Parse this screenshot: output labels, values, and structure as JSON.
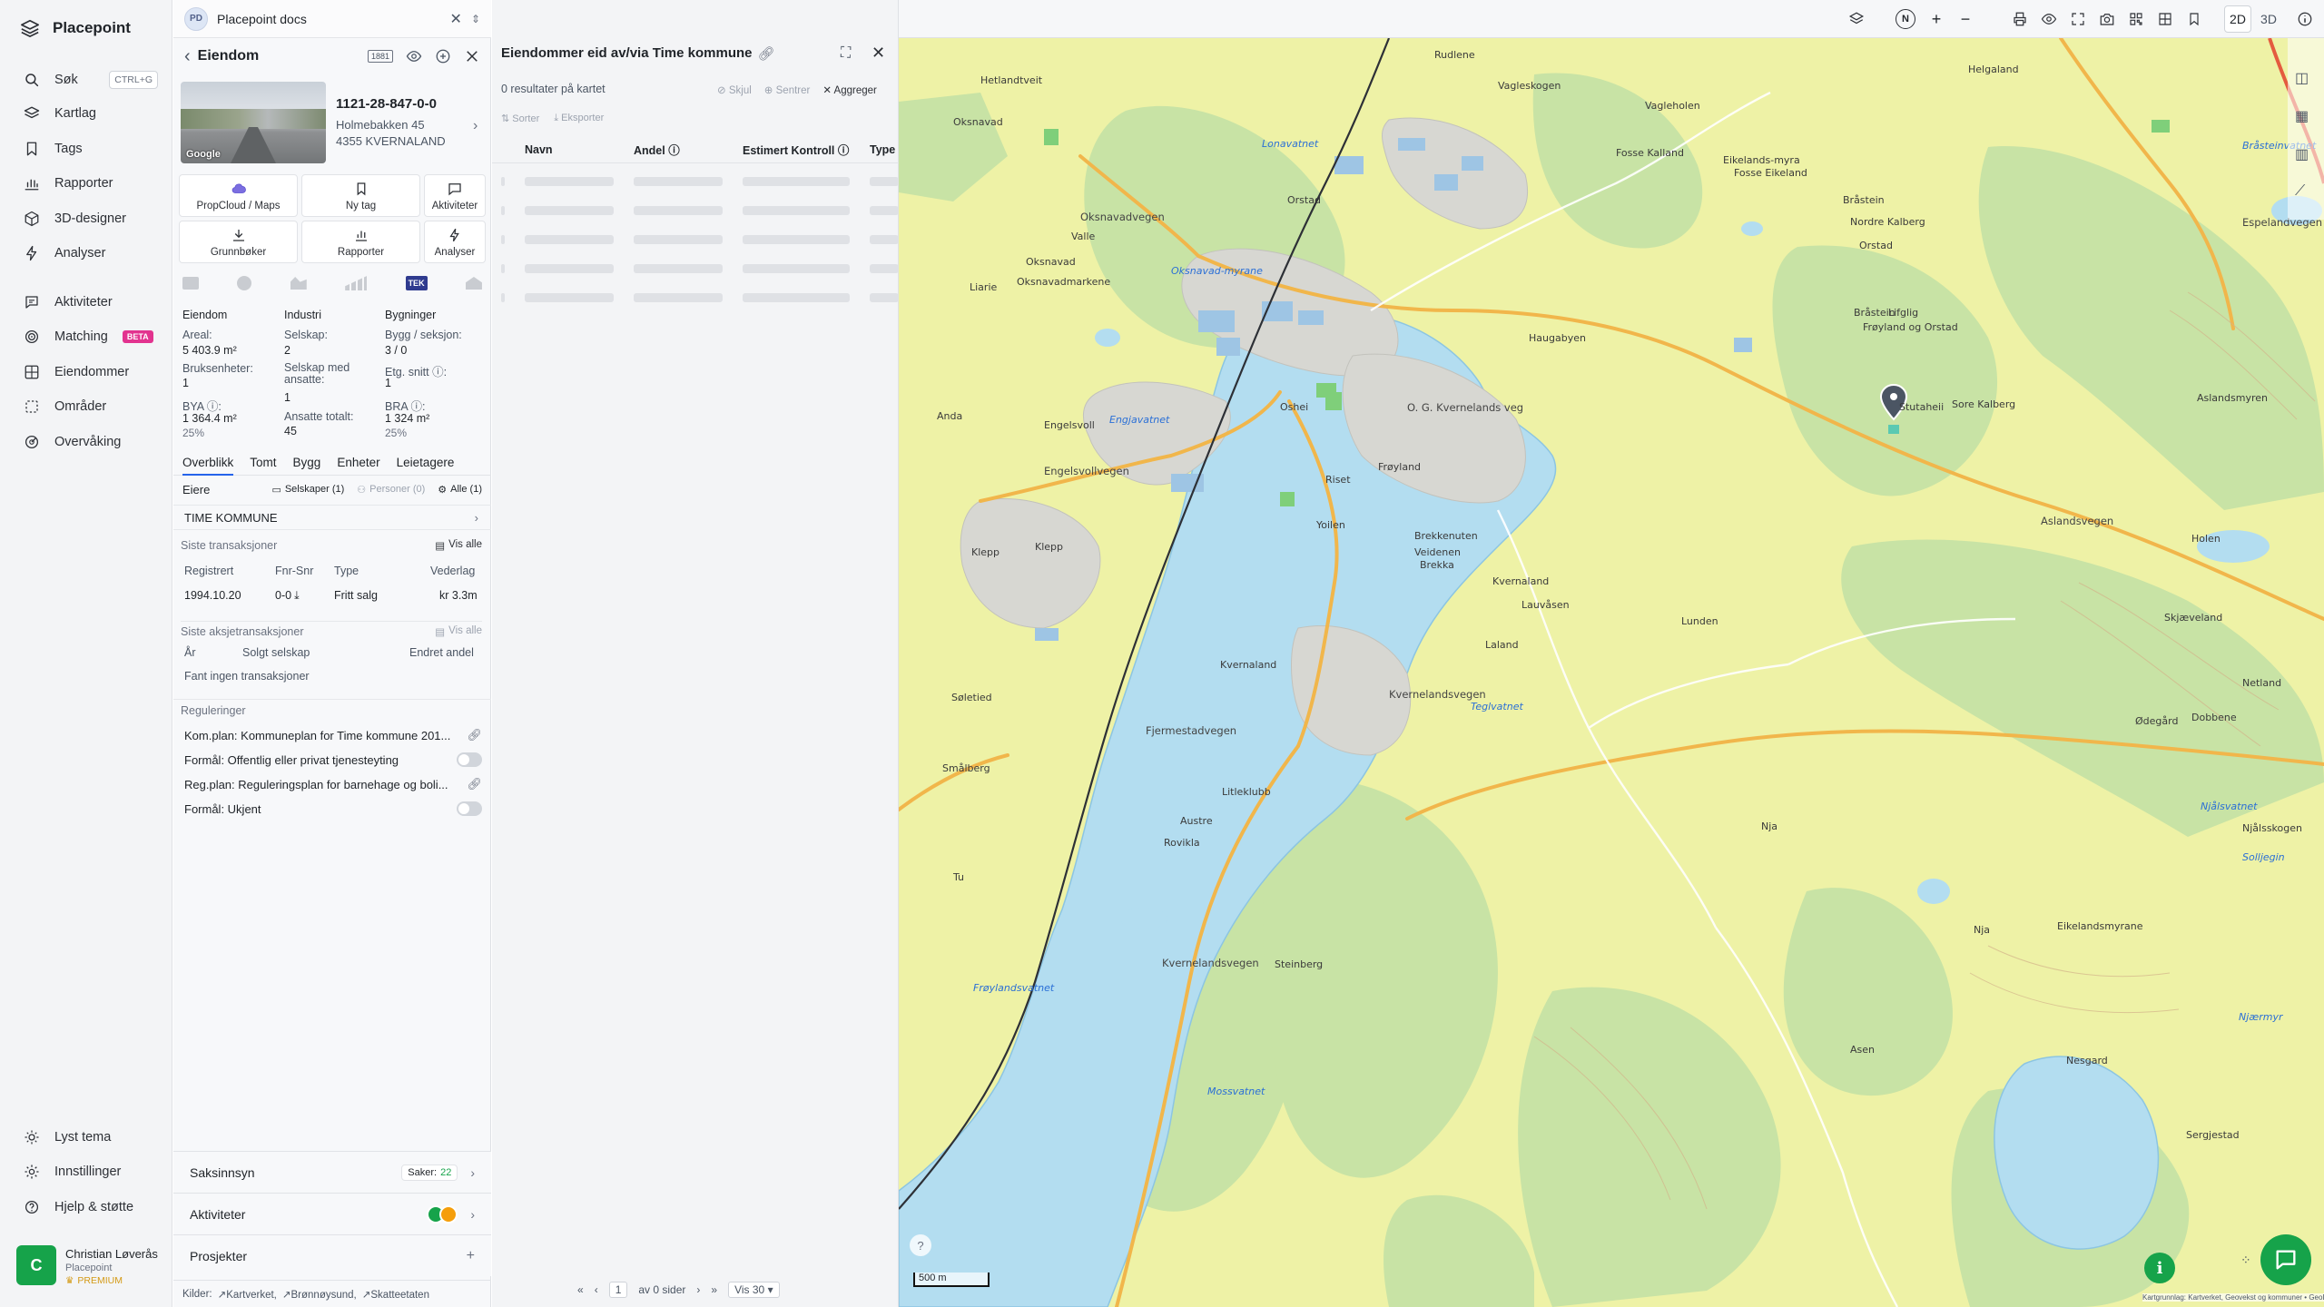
{
  "app": {
    "name": "Placepoint"
  },
  "sidebar": {
    "search": {
      "label": "Søk",
      "shortcut": "CTRL+G"
    },
    "items": [
      {
        "label": "Kartlag",
        "icon": "layers-icon"
      },
      {
        "label": "Tags",
        "icon": "bookmark-icon"
      },
      {
        "label": "Rapporter",
        "icon": "bar-chart-icon"
      },
      {
        "label": "3D-designer",
        "icon": "cube-icon"
      },
      {
        "label": "Analyser",
        "icon": "bolt-icon"
      },
      {
        "label": "Aktiviteter",
        "icon": "chat-icon"
      },
      {
        "label": "Matching",
        "icon": "target-icon",
        "badge": "BETA"
      },
      {
        "label": "Eiendommer",
        "icon": "grid-icon"
      },
      {
        "label": "Områder",
        "icon": "dashed-square-icon"
      },
      {
        "label": "Overvåking",
        "icon": "radar-icon"
      }
    ],
    "bottom": [
      {
        "label": "Lyst tema",
        "icon": "sun-icon"
      },
      {
        "label": "Innstillinger",
        "icon": "gear-icon"
      },
      {
        "label": "Hjelp & støtte",
        "icon": "help-icon"
      }
    ],
    "user": {
      "initial": "C",
      "name": "Christian Løverås",
      "org": "Placepoint",
      "plan": "PREMIUM"
    }
  },
  "property": {
    "tab": {
      "initials": "PD",
      "title": "Placepoint docs"
    },
    "header": {
      "title": "Eiendom"
    },
    "photo_label": "Google",
    "id": "1121-28-847-0-0",
    "address1": "Holmebakken 45",
    "address2": "4355 KVERNALAND",
    "actions": [
      "PropCloud / Maps",
      "Ny tag",
      "Aktiviteter",
      "Grunnbøker",
      "Rapporter",
      "Analyser"
    ],
    "tek_badge": "TEK",
    "stats": {
      "col1_title": "Eiendom",
      "col2_title": "Industri",
      "col3_title": "Bygninger",
      "areal_label": "Areal:",
      "areal": "5 403.9 m²",
      "selskap_label": "Selskap:",
      "selskap": "2",
      "bygg_label": "Bygg / seksjon:",
      "bygg": "3 / 0",
      "bruks_label": "Bruksenheter:",
      "bruks": "1",
      "selskap_ans_label": "Selskap med ansatte:",
      "selskap_ans": "1",
      "etg_label": "Etg. snitt ⓘ:",
      "etg": "1",
      "bya_label": "BYA ⓘ:",
      "bya": "1 364.4 m²",
      "bya_pct": "25%",
      "ansatte_label": "Ansatte totalt:",
      "ansatte": "45",
      "bra_label": "BRA ⓘ:",
      "bra": "1 324 m²",
      "bra_pct": "25%"
    },
    "subtabs": [
      "Overblikk",
      "Tomt",
      "Bygg",
      "Enheter",
      "Leietagere"
    ],
    "owners": {
      "label": "Eiere",
      "companies": "Selskaper (1)",
      "persons": "Personer (0)",
      "all": "Alle (1)",
      "owner": "TIME KOMMUNE"
    },
    "transactions": {
      "title": "Siste transaksjoner",
      "view_all": "Vis alle",
      "headers": [
        "Registrert",
        "Fnr-Snr",
        "Type",
        "Vederlag"
      ],
      "row": [
        "1994.10.20",
        "0-0",
        "Fritt salg",
        "kr 3.3m"
      ]
    },
    "share_transactions": {
      "title": "Siste aksjetransaksjoner",
      "view_all": "Vis alle",
      "headers": [
        "År",
        "Solgt selskap",
        "Endret andel"
      ],
      "empty": "Fant ingen transaksjoner"
    },
    "regulations": {
      "title": "Reguleringer",
      "items": [
        "Kom.plan: Kommuneplan for Time kommune 201...",
        "Formål: Offentlig eller privat tjenesteyting",
        "Reg.plan: Reguleringsplan for barnehage og boli...",
        "Formål: Ukjent"
      ]
    },
    "accordions": {
      "saksinnsyn": "Saksinnsyn",
      "saker_label": "Saker:",
      "saker_count": "22",
      "aktiviteter": "Aktiviteter",
      "prosjekter": "Prosjekter"
    },
    "sources": {
      "label": "Kilder:",
      "items": [
        "Kartverket",
        "Brønnøysund",
        "Skatteetaten"
      ]
    }
  },
  "list": {
    "title": "Eiendommer eid av/via Time kommune",
    "result": "0 resultater på kartet",
    "hide": "Skjul",
    "center": "Sentrer",
    "aggregate": "Aggreger",
    "sort": "Sorter",
    "export": "Eksporter",
    "columns": [
      "Navn",
      "Andel ⓘ",
      "Estimert Kontroll ⓘ",
      "Type"
    ],
    "pagination": {
      "page": "1",
      "of_pages": "av 0 sider",
      "per_page": "Vis 30"
    }
  },
  "map": {
    "mode_2d": "2D",
    "mode_3d": "3D",
    "scale": "500 m",
    "attribution": "Kartgrunnlag: Kartverket, Geovekst og kommuner • GeoData AS. Powered by Esri",
    "labels": [
      "Rudlene",
      "Helgaland",
      "Vagleskogen",
      "Vagleholen",
      "Hetlandtveit",
      "Oksnavad",
      "Fosse Kalland",
      "Lonavatnet",
      "Eikelands-myra",
      "Fosse Eikeland",
      "Bråstein",
      "Orstad",
      "Espelandvegen",
      "Valle",
      "Oksnavadvegen",
      "Nordre Kalberg",
      "Bråsteinvatnet",
      "Oksnavad",
      "Orstad",
      "Liarie",
      "Oksnavadmarkene",
      "Oksnavad-myrane",
      "Frøyland og Orstad",
      "Bråstein",
      "Lifglig",
      "Engelsvoll",
      "Engelsvollvegen",
      "Engjavatnet",
      "Anda",
      "Oshei",
      "O. G. Kvernelands veg",
      "Haugabyen",
      "Stutaheii",
      "Aslandsmyren",
      "Sore Kalberg",
      "Klepp",
      "Klepp",
      "Frøyland",
      "Riset",
      "Yoilen",
      "Brekkenuten",
      "Aslandsvegen",
      "Holen",
      "Veidenen",
      "Brekka",
      "Lunden",
      "Kvernaland",
      "Lauvåsen",
      "Skjæveland",
      "Netland",
      "Kvernaland",
      "Laland",
      "Søletied",
      "Teglvatnet",
      "Kvernelandsvegen",
      "Fjermestadvegen",
      "Litleklubb",
      "Dobbene",
      "Ødegård",
      "Njålsvatnet",
      "Smålberg",
      "Nja",
      "Njålsskogen",
      "Rovikla",
      "Austre",
      "Solljegin",
      "Tu",
      "Frøylandsvatnet",
      "Kvernelandsvegen",
      "Mossvatnet",
      "Nja",
      "Eikelandsmyrane",
      "Njærmyr",
      "Nesgard",
      "Sergjestad",
      "Steinberg",
      "Asen"
    ]
  }
}
